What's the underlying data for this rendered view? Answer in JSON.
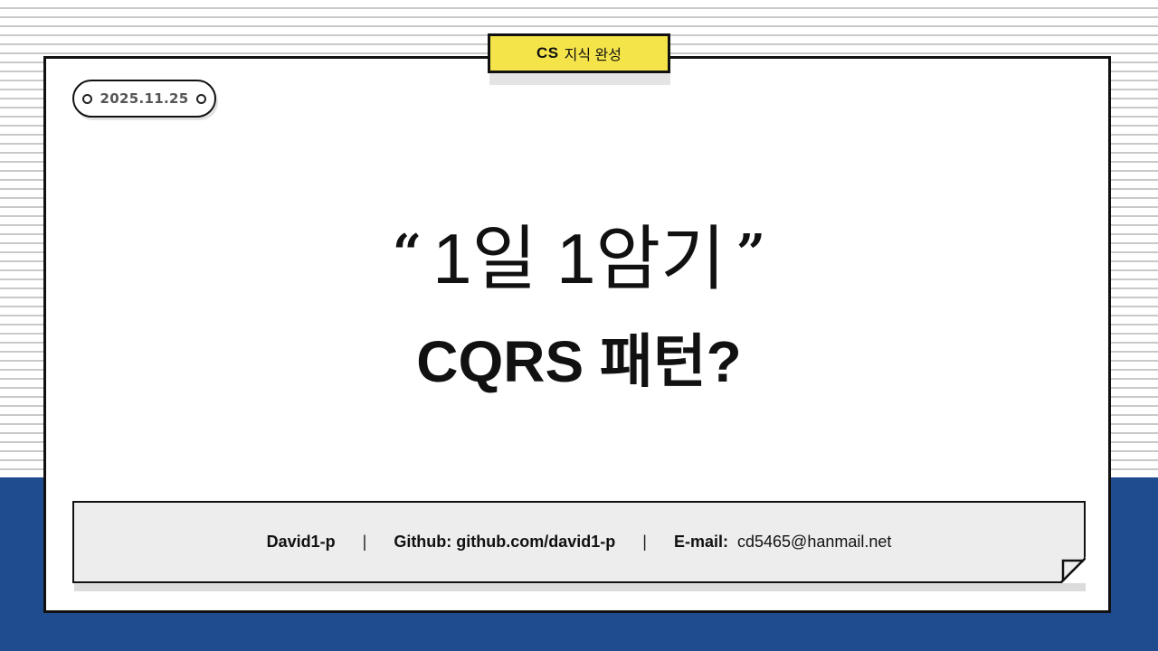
{
  "tab": {
    "strong": "CS",
    "rest": "지식 완성"
  },
  "date": "2025.11.25",
  "quote": {
    "open": "“",
    "text": "1일 1암기",
    "close": "”"
  },
  "title": "CQRS 패턴?",
  "footer": {
    "author": "David1-p",
    "separator": "|",
    "github_label": "Github: github.com/david1-p",
    "email_label": "E-mail:",
    "email_value": "cd5465@hanmail.net"
  },
  "colors": {
    "background_band": "#1f4c8f",
    "tab_yellow": "#f4e44a",
    "footer_gray": "#ededed",
    "border": "#111111"
  }
}
